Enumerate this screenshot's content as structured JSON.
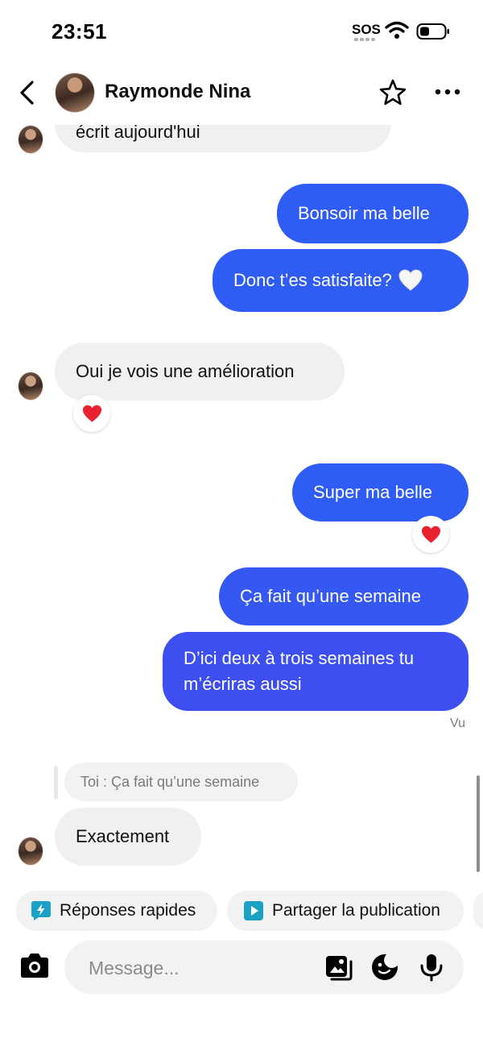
{
  "status_bar": {
    "time": "23:51",
    "sos": "SOS"
  },
  "header": {
    "contact_name": "Raymonde Nina"
  },
  "messages": {
    "cut_text": "écrit aujourd'hui",
    "out_1": "Bonsoir ma belle",
    "out_2": "Donc t’es satisfaite?",
    "in_1": "Oui je vois une amélioration",
    "out_3": "Super ma belle",
    "out_4": "Ça fait qu’une semaine",
    "out_5_line1": "D’ici deux à trois semaines tu",
    "out_5_line2": "m’écriras aussi",
    "seen": "Vu",
    "reply_quote": "Toi : Ça fait qu’une semaine",
    "in_2": "Exactement"
  },
  "quick_actions": [
    {
      "label": "Réponses rapides",
      "icon": "lightning-icon"
    },
    {
      "label": "Partager la publication",
      "icon": "play-icon"
    }
  ],
  "composer": {
    "placeholder": "Message..."
  },
  "colors": {
    "outgoing": "#2f5cf4",
    "incoming": "#f0f0f0",
    "accent_teal": "#1aa1c4"
  }
}
